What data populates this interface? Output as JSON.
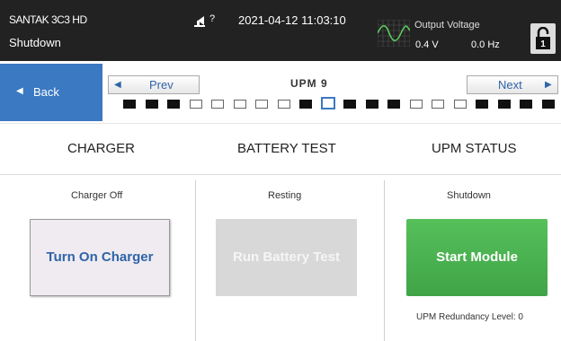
{
  "topbar": {
    "device_name": "SANTAK 3C3 HD",
    "device_status": "Shutdown",
    "alarm_count": "?",
    "datetime": "2021-04-12 11:03:10",
    "output_label": "Output Voltage",
    "output_voltage": "0.4 V",
    "output_frequency": "0.0 Hz",
    "lock_number": "1"
  },
  "nav": {
    "back_label": "Back",
    "prev_label": "Prev",
    "next_label": "Next",
    "upm_title": "UPM 9",
    "upm_states": [
      "on",
      "on",
      "on",
      "off",
      "off",
      "off",
      "off",
      "off",
      "on",
      "sel",
      "on",
      "on",
      "on",
      "off",
      "off",
      "off",
      "on",
      "on",
      "on",
      "on"
    ],
    "selected_index": 9
  },
  "headers": {
    "charger": "CHARGER",
    "battery_test": "BATTERY TEST",
    "upm_status": "UPM STATUS"
  },
  "panels": {
    "charger_status": "Charger Off",
    "charger_button": "Turn On Charger",
    "battery_status": "Resting",
    "battery_button": "Run Battery Test",
    "upm_status": "Shutdown",
    "upm_button": "Start Module",
    "redundancy_text": "UPM Redundancy Level:  0"
  },
  "icons": {
    "back": "left-triangle-icon",
    "prev": "left-triangle-icon",
    "next": "right-triangle-icon",
    "alarm": "alarm-horn-icon",
    "scope": "waveform-scope-icon",
    "lock": "padlock-icon"
  },
  "colors": {
    "topbar_bg": "#222222",
    "back_button": "#3b79c2",
    "link_blue": "#2f64a8",
    "start_green": "#4cb150",
    "disabled_gray": "#d8d8d8",
    "charger_button_bg": "#efebf0"
  }
}
